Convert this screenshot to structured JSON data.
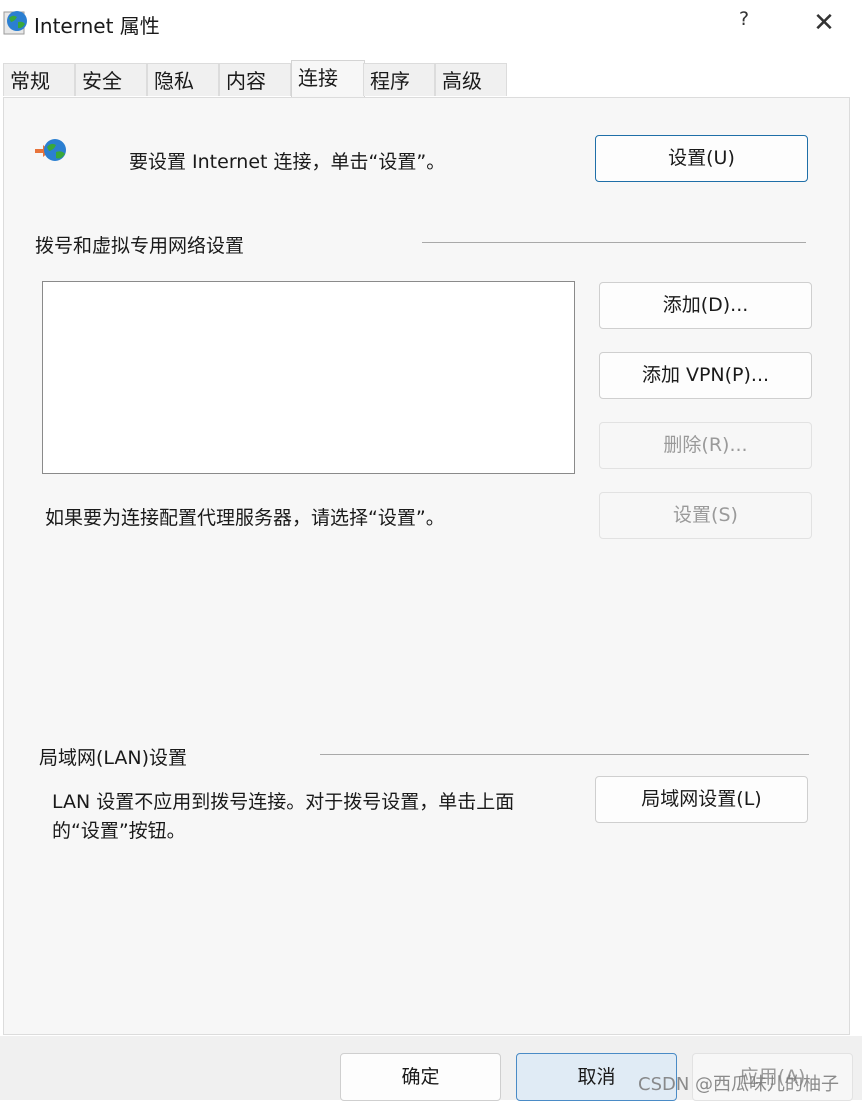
{
  "window": {
    "title": "Internet 属性",
    "help_label": "?",
    "close_label": "✕",
    "app_icon": "internet-globe-icon"
  },
  "tabs": [
    {
      "label": "常规",
      "active": false
    },
    {
      "label": "安全",
      "active": false
    },
    {
      "label": "隐私",
      "active": false
    },
    {
      "label": "内容",
      "active": false
    },
    {
      "label": "连接",
      "active": true
    },
    {
      "label": "程序",
      "active": false
    },
    {
      "label": "高级",
      "active": false
    }
  ],
  "connection": {
    "icon": "network-globe-icon",
    "intro_text": "要设置 Internet 连接，单击“设置”。",
    "setup_button": "设置(U)"
  },
  "dialup": {
    "section_title": "拨号和虚拟专用网络设置",
    "connections": [],
    "add_button": "添加(D)...",
    "add_vpn_button": "添加 VPN(P)...",
    "remove_button": "删除(R)...",
    "settings_button": "设置(S)",
    "proxy_text": "如果要为连接配置代理服务器，请选择“设置”。"
  },
  "lan": {
    "section_title": "局域网(LAN)设置",
    "description_line1": "LAN 设置不应用到拨号连接。对于拨号设置，单击上面",
    "description_line2": "的“设置”按钮。",
    "lan_settings_button": "局域网设置(L)"
  },
  "footer": {
    "ok_button": "确定",
    "cancel_button": "取消",
    "apply_button": "应用(A)"
  },
  "watermark": "CSDN @西瓜味儿的柚子",
  "colors": {
    "accent_border": "#1f6fa8",
    "panel_bg": "#f7f7f7",
    "disabled_text": "#9a9a9a"
  }
}
